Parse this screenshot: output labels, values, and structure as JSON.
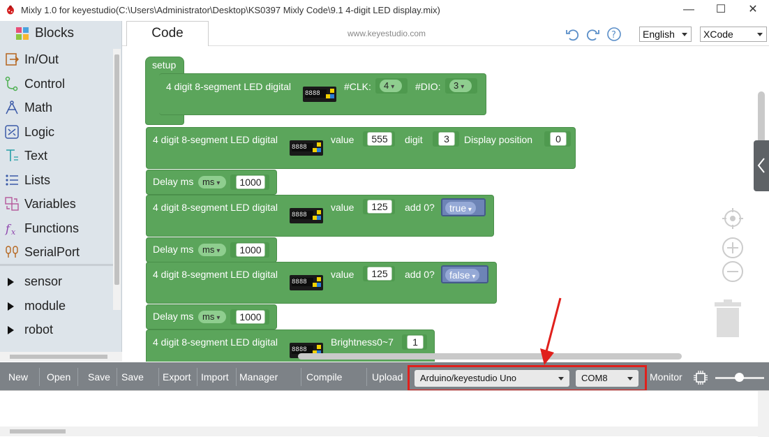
{
  "window": {
    "title": "Mixly 1.0 for keyestudio(C:\\Users\\Administrator\\Desktop\\KS0397 Mixly Code\\9.1 4-digit LED display.mix)",
    "minimize": "—",
    "maximize": "☐",
    "close": "✕"
  },
  "toolbox": {
    "header": "Blocks",
    "categories": [
      {
        "label": "In/Out"
      },
      {
        "label": "Control"
      },
      {
        "label": "Math"
      },
      {
        "label": "Logic"
      },
      {
        "label": "Text"
      },
      {
        "label": "Lists"
      },
      {
        "label": "Variables"
      },
      {
        "label": "Functions"
      },
      {
        "label": "SerialPort"
      }
    ],
    "groups": [
      {
        "label": "sensor"
      },
      {
        "label": "module"
      },
      {
        "label": "robot"
      }
    ]
  },
  "topbar": {
    "tab": "Code",
    "site": "www.keyestudio.com",
    "language": "English",
    "theme": "XCode"
  },
  "blocks": {
    "setup": {
      "label": "setup",
      "init_label": "4 digit 8-segment LED digital",
      "clk_label": "#CLK:",
      "clk_value": "4",
      "dio_label": "#DIO:",
      "dio_value": "3"
    },
    "display1": {
      "label": "4 digit 8-segment LED digital",
      "value_label": "value",
      "value": "555",
      "digit_label": "digit",
      "digit": "3",
      "pos_label": "Display position",
      "pos": "0"
    },
    "delay1": {
      "label": "Delay ms",
      "unit": "ms",
      "value": "1000"
    },
    "display2": {
      "label": "4 digit 8-segment LED digital",
      "value_label": "value",
      "value": "125",
      "add_label": "add 0?",
      "add_value": "true"
    },
    "delay2": {
      "label": "Delay ms",
      "unit": "ms",
      "value": "1000"
    },
    "display3": {
      "label": "4 digit 8-segment LED digital",
      "value_label": "value",
      "value": "125",
      "add_label": "add 0?",
      "add_value": "false"
    },
    "delay3": {
      "label": "Delay ms",
      "unit": "ms",
      "value": "1000"
    },
    "brightness": {
      "label": "4 digit 8-segment LED digital",
      "bright_label": "Brightness0~7",
      "value": "1"
    }
  },
  "bottombar": {
    "buttons": [
      "New",
      "Open",
      "Save",
      "Save as",
      "Export",
      "Import",
      "Manager",
      "Compile",
      "Upload"
    ],
    "board": "Arduino/keyestudio Uno",
    "port": "COM8",
    "monitor": "Monitor"
  },
  "colors": {
    "block_green": "#5ba55b",
    "bool_blue": "#6d84b6",
    "toolbar_gray": "#7d8287",
    "highlight_red": "#e0201c"
  }
}
